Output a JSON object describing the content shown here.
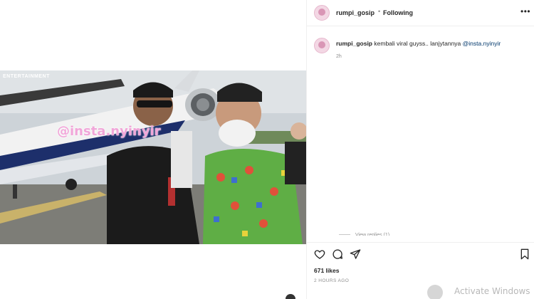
{
  "header": {
    "username": "rumpi_gosip",
    "separator": "•",
    "follow_label": "Following",
    "more_icon": "more-horizontal-icon"
  },
  "media": {
    "brand_watermark": "ENTERTAINMENT",
    "overlay_handle": "@insta.nyinyir"
  },
  "caption": {
    "username": "rumpi_gosip",
    "text": "kembali viral guyss.. lanjytannya",
    "mention": "@insta.nyinyir",
    "time": "2h"
  },
  "replies": {
    "label": "View replies (1)"
  },
  "actions": {
    "like_icon": "heart-icon",
    "comment_icon": "comment-icon",
    "share_icon": "share-icon",
    "save_icon": "bookmark-icon"
  },
  "stats": {
    "likes": "671 likes",
    "posted": "2 HOURS AGO"
  },
  "os_watermark": {
    "text": "Activate Windows"
  }
}
